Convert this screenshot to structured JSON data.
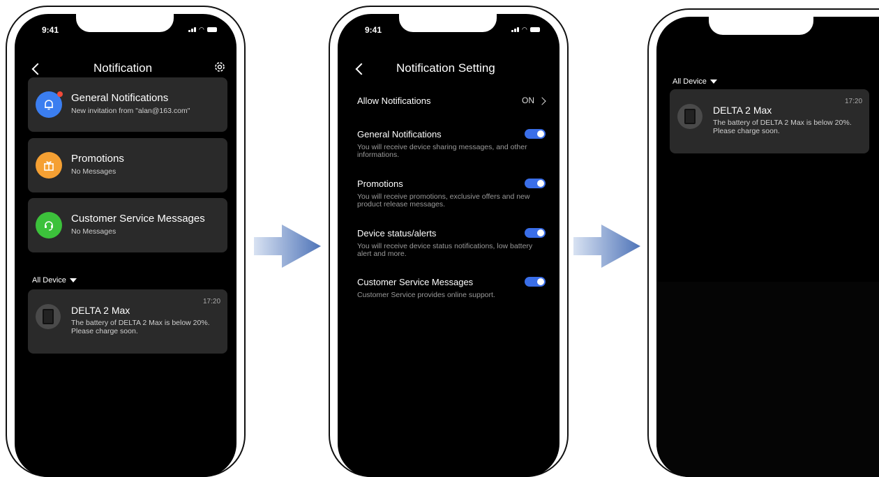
{
  "screen1": {
    "status_time": "9:41",
    "title": "Notification",
    "cards": [
      {
        "title": "General Notifications",
        "subtitle": "New invitation from \"alan@163.com\"",
        "icon": "bell-icon",
        "color": "#3b7ef0"
      },
      {
        "title": "Promotions",
        "subtitle": "No Messages",
        "icon": "gift-icon",
        "color": "#f5a033"
      },
      {
        "title": "Customer Service Messages",
        "subtitle": "No Messages",
        "icon": "headset-icon",
        "color": "#3cc13b"
      }
    ],
    "filter": "All Device",
    "device": {
      "name": "DELTA 2 Max",
      "message": "The battery of DELTA 2 Max is below 20%. Please charge soon.",
      "time": "17:20"
    }
  },
  "screen2": {
    "status_time": "9:41",
    "title": "Notification Setting",
    "allow_label": "Allow Notifications",
    "allow_value": "ON",
    "settings": [
      {
        "label": "General Notifications",
        "desc": "You will receive device sharing messages, and other informations."
      },
      {
        "label": "Promotions",
        "desc": "You will receive promotions, exclusive offers and new product release messages."
      },
      {
        "label": "Device status/alerts",
        "desc": "You will receive device status notifications, low battery alert and more."
      },
      {
        "label": "Customer Service Messages",
        "desc": "Customer Service provides online support."
      }
    ]
  },
  "screen3": {
    "filter": "All Device",
    "device": {
      "name": "DELTA 2 Max",
      "message": "The battery of DELTA 2 Max is below 20%. Please charge soon.",
      "time": "17:20"
    }
  },
  "colors": {
    "toggle_on": "#3a6ee8",
    "card_bg": "#2a2a2a",
    "arrow": "#5b7fc0"
  }
}
